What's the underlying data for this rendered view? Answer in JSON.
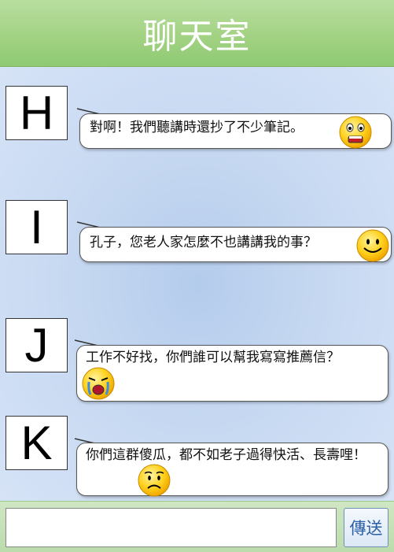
{
  "header": {
    "title": "聊天室"
  },
  "messages": [
    {
      "avatar": "H",
      "text": "對啊！我們聽講時還抄了不少筆記。",
      "emoji": "surprised-face-icon"
    },
    {
      "avatar": "I",
      "text": "孔子，您老人家怎麼不也講講我的事？",
      "emoji": "smiling-face-icon"
    },
    {
      "avatar": "J",
      "text": "工作不好找，你們誰可以幫我寫寫推薦信？",
      "emoji": "crying-face-icon"
    },
    {
      "avatar": "K",
      "text": "你們這群傻瓜，都不如老子過得快活、長壽哩！",
      "emoji": "worried-face-icon"
    }
  ],
  "footer": {
    "input_value": "",
    "send_label": "傳送"
  },
  "colors": {
    "header_green": "#a2d283",
    "chat_blue": "#c6d8f1",
    "send_text": "#2a5ea8"
  }
}
